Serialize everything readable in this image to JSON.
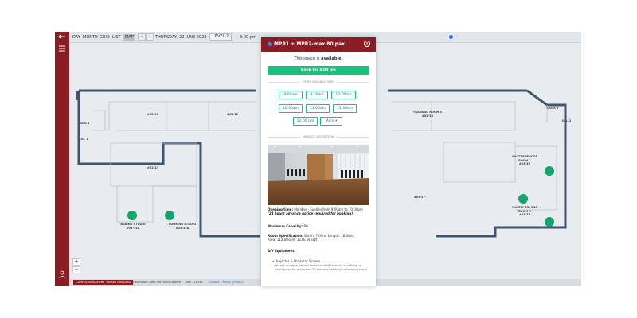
{
  "toolbar": {
    "views": [
      "DAY",
      "MONTH",
      "GRID",
      "LIST",
      "MAP"
    ],
    "active_view": "MAP",
    "prev_label": "‹",
    "next_label": "›",
    "date": "THURSDAY, 22 JUNE 2023",
    "level": "LEVEL 2",
    "time": "3:00 pm"
  },
  "rooms": [
    {
      "label": "#02-31"
    },
    {
      "label": "#02-32"
    },
    {
      "label": "#02-33"
    },
    {
      "label": "STAIR 1"
    },
    {
      "label": "SIG. 1"
    },
    {
      "label": "TRAINING ROOM 3\n#02-30"
    },
    {
      "label": "STAIR 2"
    },
    {
      "label": "SIG. 2"
    },
    {
      "label": "#03-37"
    },
    {
      "label": "BAKING STUDIO\n#02-34A"
    },
    {
      "label": "COOKING STUDIO\n#03-35A"
    },
    {
      "label": "MULTI PURPOSE\nROOM 1\n#03-39"
    },
    {
      "label": "MULTI PURPOSE\nROOM 2\n#02-38"
    }
  ],
  "zoom": {
    "in": "+",
    "out": "−"
  },
  "statusbar": {
    "campus": "CAMPUS SINGAPORE · HEART BUILDING",
    "text1": "Last Room Code not found/update",
    "text2": "Total 142345",
    "link": "Contact | Terms | Privacy"
  },
  "modal": {
    "title": "MPR1 + MPR2-max 80 pax",
    "close": "×",
    "availability_prefix": "This space is ",
    "availability_status": "available:",
    "book_button": "Book for 3:00 pm",
    "other_times_label": "OTHER AVAILABLE TIMES",
    "slots": [
      "9:00am",
      "9:30am",
      "10:00am",
      "10:30am",
      "11:00am",
      "11:30am",
      "12:00 pm"
    ],
    "more_label": "More ▾",
    "images_label": "IMAGES & DESCRIPTION",
    "opening_label": "Opening time:",
    "opening_value": " Monday - Sunday from 9:00am to 10:00pm",
    "opening_note": "(24 hours advance notice required for booking)",
    "capacity_label": "Maximum Capacity:",
    "capacity_value": " 80",
    "spec_label": "Room Specification:",
    "spec_value": " Width: 7.00m, Length: 18.00m,",
    "spec_area": "Area: 113.00sqm, 1216.34 sqft",
    "av_label": "A/V Equipment:",
    "av_item": "Projector & Projector Screen",
    "av_note": "*HI will assign a trained technical staff to assist in setting up your laptop for projection 30 minutes before your booking starts."
  },
  "colors": {
    "brand_red": "#8a1d24",
    "accent_green": "#17c17e",
    "pin_green": "#12a66a",
    "link_blue": "#2d6fd8"
  },
  "icons": {
    "rail_top": "menu-icon",
    "rail_bottom": "user-icon",
    "modal_close": "close-circle-icon"
  }
}
